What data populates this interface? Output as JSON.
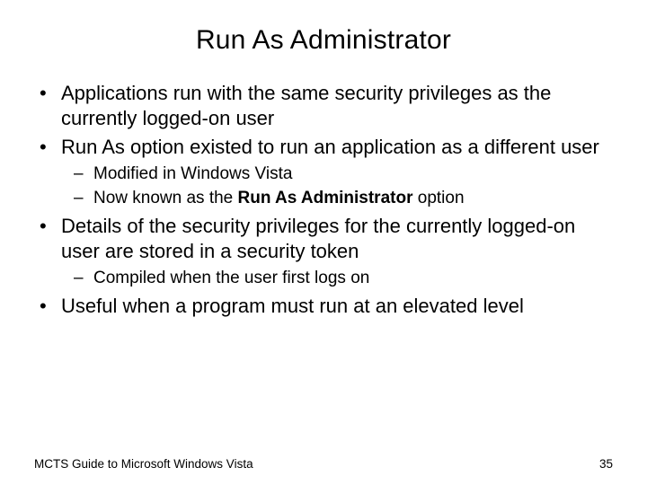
{
  "title": "Run As Administrator",
  "bullets": {
    "b1": "Applications run with the same security privileges as the currently logged-on user",
    "b2": "Run As option existed to run an application as a different user",
    "b2_sub1": "Modified in Windows Vista",
    "b2_sub2_pre": "Now known as the ",
    "b2_sub2_bold": "Run As Administrator",
    "b2_sub2_post": " option",
    "b3": "Details of the security privileges for the currently logged-on user are stored in a security token",
    "b3_sub1": "Compiled when the user first logs on",
    "b4": "Useful when a program must run at an elevated level"
  },
  "footer": {
    "source": "MCTS Guide to Microsoft Windows Vista",
    "page": "35"
  }
}
